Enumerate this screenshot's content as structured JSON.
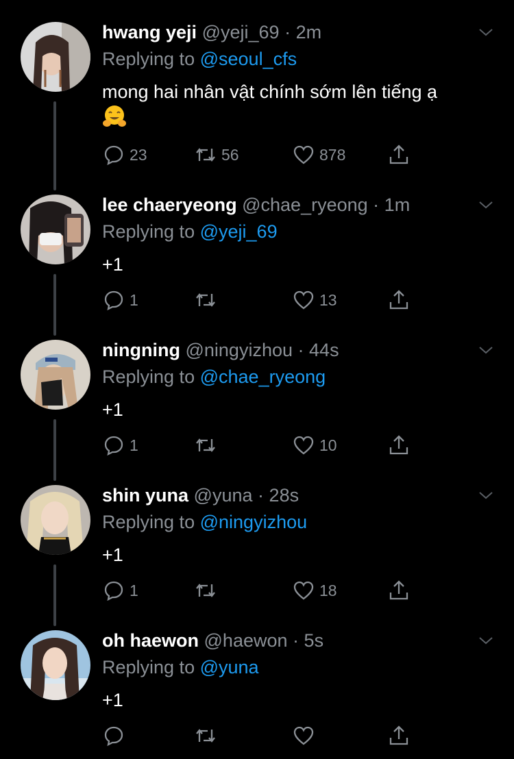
{
  "replying_prefix": "Replying to",
  "dot": "·",
  "tweets": [
    {
      "name": "hwang yeji",
      "handle": "@yeji_69",
      "time": "2m",
      "reply_to": "@seoul_cfs",
      "text": "mong hai nhân vật chính sớm lên tiếng ạ",
      "emoji": "hugging-face",
      "replies": "23",
      "retweets": "56",
      "likes": "878"
    },
    {
      "name": "lee chaeryeong",
      "handle": "@chae_ryeong",
      "time": "1m",
      "reply_to": "@yeji_69",
      "text": "+1",
      "replies": "1",
      "retweets": "",
      "likes": "13"
    },
    {
      "name": "ningning",
      "handle": "@ningyizhou",
      "time": "44s",
      "reply_to": "@chae_ryeong",
      "text": "+1",
      "replies": "1",
      "retweets": "",
      "likes": "10"
    },
    {
      "name": "shin yuna",
      "handle": "@yuna",
      "time": "28s",
      "reply_to": "@ningyizhou",
      "text": "+1",
      "replies": "1",
      "retweets": "",
      "likes": "18"
    },
    {
      "name": "oh haewon",
      "handle": "@haewon",
      "time": "5s",
      "reply_to": "@yuna",
      "text": "+1",
      "replies": "",
      "retweets": "",
      "likes": ""
    }
  ],
  "colors": {
    "background": "#000000",
    "name": "#ffffff",
    "muted": "#8b9096",
    "mention": "#1d9bf0",
    "thread_line": "#3d4146"
  },
  "icons": [
    "reply-icon",
    "retweet-icon",
    "like-icon",
    "share-icon",
    "chevron-down-icon",
    "hugging-face-emoji"
  ]
}
